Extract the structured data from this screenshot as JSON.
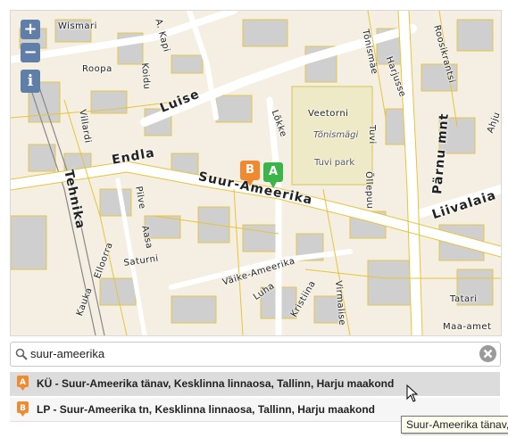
{
  "map": {
    "controls": {
      "zoom_in": "+",
      "zoom_out": "−",
      "info": "i"
    },
    "streets": {
      "wismari": "Wismari",
      "kapi": "A. Kapi",
      "roopa": "Roopa",
      "koidu": "Koidu",
      "luise": "Luise",
      "villardi": "Villardi",
      "lokke": "Lõkke",
      "endla": "Endla",
      "suur_ameerika": "Suur-Ameerika",
      "tehnika": "Tehnika",
      "pilve": "Pilve",
      "aasa": "Aasa",
      "saturni": "Saturni",
      "veetorni": "Veetorni",
      "tonismagi_area": "Tõnismägi",
      "tonismagi_st": "Tõnismägi",
      "tuvi": "Tuvi",
      "tuvi_park": "Tuvi park",
      "ollepuu": "Õllepuu",
      "harjusse": "Harjusse",
      "tonismae": "Tõnismäe",
      "roosikrantsi": "Roosikrantsi",
      "parnu_mnt": "Pärnu mnt",
      "liivalaia": "Liivalaia",
      "ahju": "Ahju",
      "vaike_ameerika": "Väike-Ameerika",
      "luha": "Luha",
      "kristiina": "Kristiina",
      "virmalise": "Virmalise",
      "tatari": "Tatari",
      "maa_amet": "Maa-amet",
      "kauka": "Kauka",
      "elloorra": "Elloorra"
    },
    "markers": [
      {
        "letter": "B",
        "color": "#f08a30"
      },
      {
        "letter": "A",
        "color": "#3bb54a"
      }
    ]
  },
  "search": {
    "value": "suur-ameerika",
    "icon": "search-icon",
    "clear_icon": "clear-icon"
  },
  "results": [
    {
      "letter": "A",
      "label": "KÜ - Suur-Ameerika tänav, Kesklinna linnaosa, Tallinn, Harju maakond"
    },
    {
      "letter": "B",
      "label": "LP - Suur-Ameerika tn, Kesklinna linnaosa, Tallinn, Harju maakond"
    }
  ],
  "tooltip": {
    "text": "Suur-Ameerika tänav,"
  },
  "colors": {
    "marker_a": "#3bb54a",
    "marker_b": "#f08a30",
    "control": "#5f7fa8",
    "result_icon": "#f08a30"
  }
}
